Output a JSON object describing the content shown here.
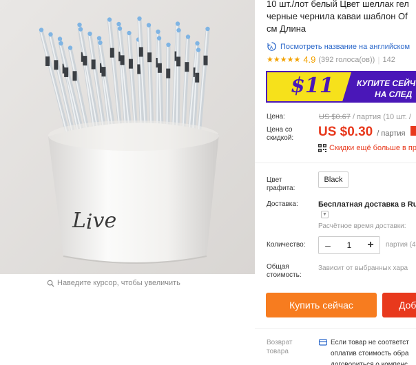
{
  "product": {
    "title_lines": [
      "10 шт./лот белый Цвет шеллак гел",
      "черные чернила каваи шаблон Of",
      "см Длина"
    ],
    "translate_link": "Посмотреть название на английском",
    "rating": {
      "stars": "★★★★★",
      "score": "4.9",
      "votes": "(392 голоса(ов))",
      "orders": "142"
    }
  },
  "banner": {
    "amount": "$11",
    "text_line1": "КУПИТЕ СЕЙЧ",
    "text_line2": "НА СЛЕД"
  },
  "price": {
    "label": "Цена:",
    "old": "US $0.67",
    "old_unit": "/ партия",
    "old_extra": "(10 шт. /",
    "discount_label": "Цена со скидкой:",
    "new": "US $0.30",
    "new_unit": "/ партия",
    "discount_more": "Скидки ещё больше в пр"
  },
  "options": {
    "color_label": "Цвет графита:",
    "color_value": "Black",
    "shipping_label": "Доставка:",
    "shipping_value": "Бесплатная доставка в Ru",
    "shipping_time": "Расчётное время доставки:",
    "qty_label": "Количество:",
    "qty_value": "1",
    "qty_unit": "партия (4",
    "total_label": "Общая стоимость:",
    "total_value": "Зависит от выбранных хара"
  },
  "actions": {
    "buy_now": "Купить сейчас",
    "add_to_cart": "Доб"
  },
  "returns": {
    "label": "Возврат товара",
    "lines": [
      "Если товар не соответст",
      "оплатив стоимость обра",
      "договориться о компенс"
    ]
  },
  "zoom_hint": "Наведите курсор, чтобы увеличить",
  "image_text": "Live",
  "colors": {
    "price_red": "#e8391d",
    "buy_orange": "#f77c1f",
    "link_blue": "#2a67c9",
    "star_gold": "#f2a100",
    "banner_yellow": "#f6e11b",
    "banner_purple": "#4a17b8"
  }
}
